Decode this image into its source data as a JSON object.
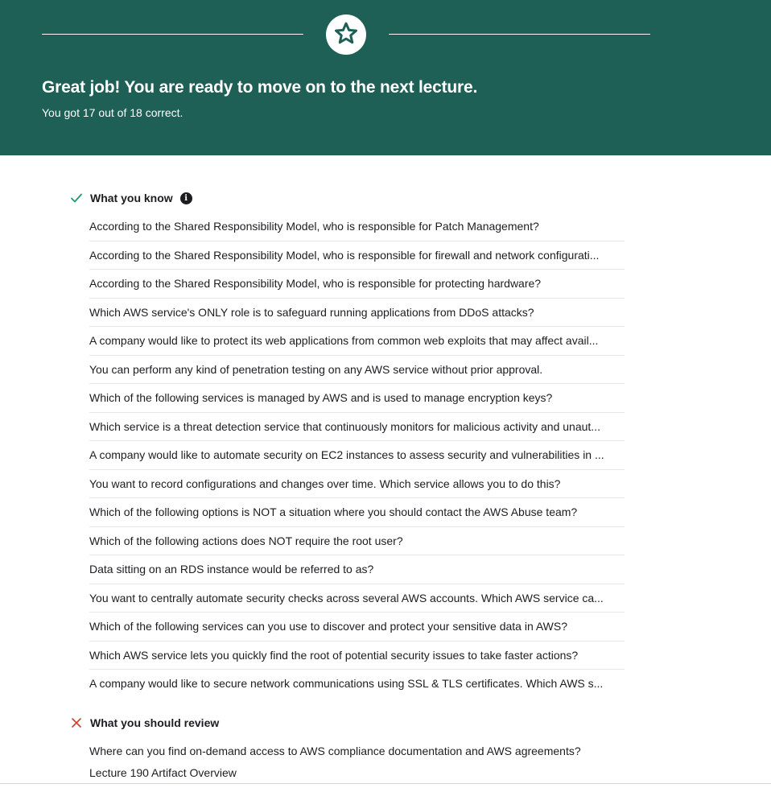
{
  "banner": {
    "icon": "star-icon",
    "title": "Great job! You are ready to move on to the next lecture.",
    "subtitle": "You got 17 out of 18 correct.",
    "background": "#1e5f56"
  },
  "know_section": {
    "icon": "check-icon",
    "icon_color": "#1e9e6a",
    "title": "What you know",
    "info_icon": "info-icon",
    "questions": [
      "According to the Shared Responsibility Model, who is responsible for Patch Management?",
      "According to the Shared Responsibility Model, who is responsible for firewall and network configurati...",
      "According to the Shared Responsibility Model, who is responsible for protecting hardware?",
      "Which AWS service's ONLY role is to safeguard running applications from DDoS attacks?",
      "A company would like to protect its web applications from common web exploits that may affect avail...",
      "You can perform any kind of penetration testing on any AWS service without prior approval.",
      "Which of the following services is managed by AWS and is used to manage encryption keys?",
      "Which service is a threat detection service that continuously monitors for malicious activity and unaut...",
      "A company would like to automate security on EC2 instances to assess security and vulnerabilities in ...",
      "You want to record configurations and changes over time. Which service allows you to do this?",
      "Which of the following options is NOT a situation where you should contact the AWS Abuse team?",
      "Which of the following actions does NOT require the root user?",
      "Data sitting on an RDS instance would be referred to as?",
      "You want to centrally automate security checks across several AWS accounts. Which AWS service ca...",
      "Which of the following services can you use to discover and protect your sensitive data in AWS?",
      "Which AWS service lets you quickly find the root of potential security issues to take faster actions?",
      "A company would like to secure network communications using SSL & TLS certificates. Which AWS s..."
    ]
  },
  "review_section": {
    "icon": "x-icon",
    "icon_color": "#d0402a",
    "title": "What you should review",
    "questions": [
      "Where can you find on-demand access to AWS compliance documentation and AWS agreements?"
    ],
    "lecture_link": "Lecture 190 Artifact Overview"
  }
}
